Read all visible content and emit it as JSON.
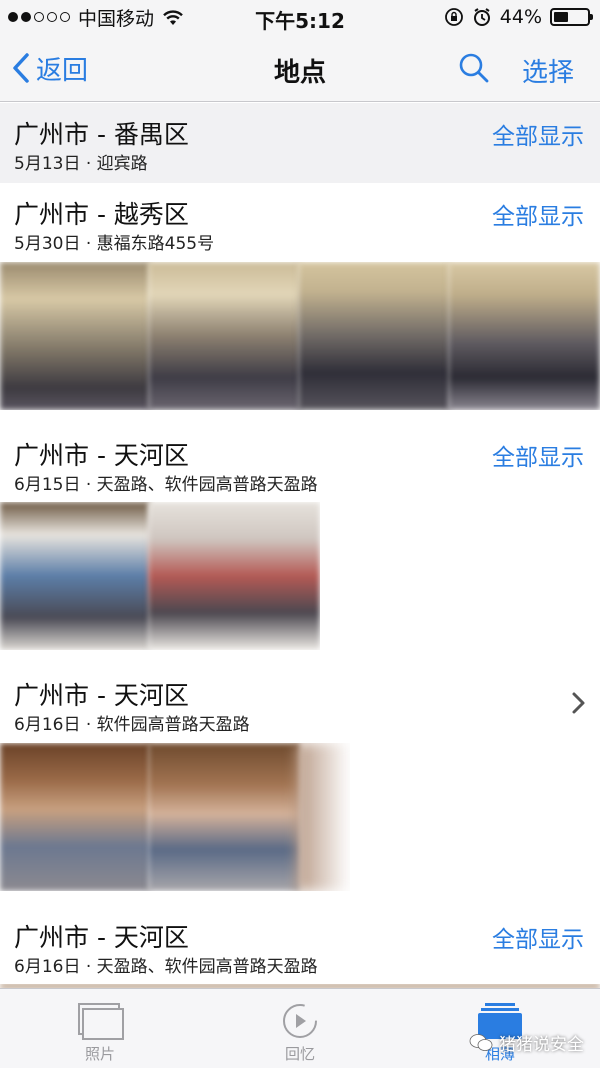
{
  "status_bar": {
    "carrier": "中国移动",
    "time": "下午5:12",
    "battery": "44%",
    "battery_level": 0.44
  },
  "nav": {
    "back_label": "返回",
    "title": "地点",
    "select_label": "选择"
  },
  "sections": [
    {
      "title": "广州市 - 番禺区",
      "subtitle": "5月13日 · 迎宾路",
      "action": "全部显示"
    },
    {
      "title": "广州市 - 越秀区",
      "subtitle": "5月30日 · 惠福东路455号",
      "action": "全部显示"
    },
    {
      "title": "广州市 - 天河区",
      "subtitle": "6月15日 · 天盈路、软件园高普路天盈路",
      "action": "全部显示"
    },
    {
      "title": "广州市 - 天河区",
      "subtitle": "6月16日 · 软件园高普路天盈路",
      "action": ""
    },
    {
      "title": "广州市 - 天河区",
      "subtitle": "6月16日 · 天盈路、软件园高普路天盈路",
      "action": "全部显示"
    }
  ],
  "tabs": [
    {
      "label": "照片",
      "icon": "photos-icon"
    },
    {
      "label": "回忆",
      "icon": "memories-icon"
    },
    {
      "label": "相薄",
      "icon": "albums-icon"
    }
  ],
  "watermark": "猪猪说安全",
  "colors": {
    "accent": "#2a7de1",
    "bar_background": "#f5f5f6",
    "pinned_header": "#f1f1f3"
  }
}
